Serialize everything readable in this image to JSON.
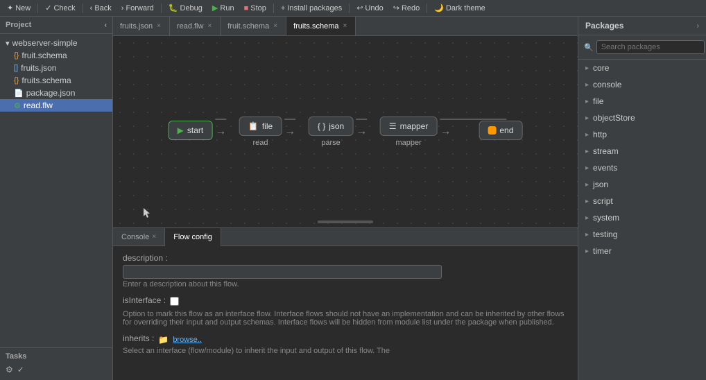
{
  "toolbar": {
    "new_label": "New",
    "check_label": "Check",
    "back_label": "Back",
    "forward_label": "Forward",
    "debug_label": "Debug",
    "run_label": "Run",
    "stop_label": "Stop",
    "install_label": "Install packages",
    "undo_label": "Undo",
    "redo_label": "Redo",
    "dark_theme_label": "Dark theme"
  },
  "sidebar": {
    "title": "Project",
    "project_name": "webserver-simple",
    "items": [
      {
        "label": "fruit.schema",
        "icon": "{}",
        "type": "schema"
      },
      {
        "label": "fruits.json",
        "icon": "[]",
        "type": "json"
      },
      {
        "label": "fruits.schema",
        "icon": "{}",
        "type": "schema"
      },
      {
        "label": "package.json",
        "icon": "📄",
        "type": "file"
      },
      {
        "label": "read.flw",
        "icon": "⚙",
        "type": "flow",
        "selected": true
      }
    ]
  },
  "tasks": {
    "label": "Tasks"
  },
  "tabs": [
    {
      "label": "fruits.json",
      "active": false,
      "closeable": true
    },
    {
      "label": "read.flw",
      "active": false,
      "closeable": true
    },
    {
      "label": "fruit.schema",
      "active": false,
      "closeable": true
    },
    {
      "label": "fruits.schema",
      "active": true,
      "closeable": true
    }
  ],
  "flow": {
    "nodes": [
      {
        "id": "start",
        "label": "start",
        "sublabel": "",
        "type": "start"
      },
      {
        "id": "file",
        "label": "file",
        "sublabel": "read",
        "type": "normal"
      },
      {
        "id": "json",
        "label": "json",
        "sublabel": "parse",
        "type": "normal"
      },
      {
        "id": "mapper",
        "label": "mapper",
        "sublabel": "mapper",
        "type": "normal"
      },
      {
        "id": "end",
        "label": "end",
        "sublabel": "",
        "type": "end"
      }
    ]
  },
  "bottom_tabs": [
    {
      "label": "Console",
      "active": false,
      "closeable": true
    },
    {
      "label": "Flow config",
      "active": true,
      "closeable": false
    }
  ],
  "flow_config": {
    "description_label": "description :",
    "description_placeholder": "",
    "description_hint": "Enter a description about this flow.",
    "is_interface_label": "isInterface :",
    "is_interface_hint": "Option to mark this flow as an interface flow. Interface flows should not have an implementation and can be inherited by other flows for overriding their input and output schemas. Interface flows will be hidden from module list under the package when published.",
    "inherits_label": "inherits :",
    "inherits_browse": "browse..",
    "inherits_hint": "Select an interface (flow/module) to inherit the input and output of this flow. The"
  },
  "packages": {
    "title": "Packages",
    "search_placeholder": "Search packages",
    "add_btn_label": "+",
    "items": [
      "core",
      "console",
      "file",
      "objectStore",
      "http",
      "stream",
      "events",
      "json",
      "script",
      "system",
      "testing",
      "timer"
    ]
  }
}
